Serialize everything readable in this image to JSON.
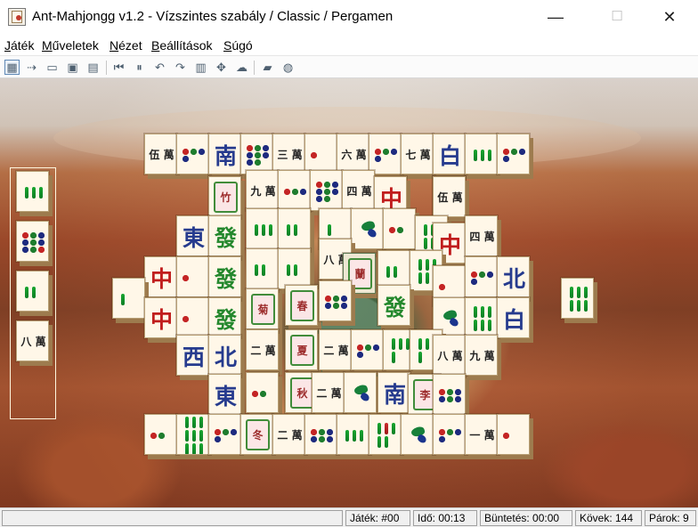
{
  "window": {
    "title": "Ant-Mahjongg v1.2 - Vízszintes szabály / Classic / Pergamen",
    "minimize": "—",
    "maximize": "☐",
    "close": "✕"
  },
  "menu": [
    "Játék",
    "Műveletek",
    "Nézet",
    "Beállítások",
    "Súgó"
  ],
  "toolbar": [
    {
      "icon": "new-game-icon",
      "glyph": "▦"
    },
    {
      "icon": "restart-icon",
      "glyph": "⇢"
    },
    {
      "icon": "open-icon",
      "glyph": "▭"
    },
    {
      "icon": "save-icon",
      "glyph": "▣"
    },
    {
      "icon": "save-as-icon",
      "glyph": "▤"
    },
    {
      "icon": "undo-all-icon",
      "glyph": "⏮"
    },
    {
      "icon": "pause-icon",
      "glyph": "⏸"
    },
    {
      "icon": "undo-icon",
      "glyph": "↶"
    },
    {
      "icon": "redo-icon",
      "glyph": "↷"
    },
    {
      "icon": "show-moves-icon",
      "glyph": "▥"
    },
    {
      "icon": "shuffle-icon",
      "glyph": "✥"
    },
    {
      "icon": "hint-icon",
      "glyph": "☁"
    },
    {
      "icon": "help-book-icon",
      "glyph": "▰"
    },
    {
      "icon": "about-icon",
      "glyph": "◍"
    }
  ],
  "board": {
    "background": "canyon",
    "selected_tile": "蘭",
    "tiles": [
      [
        "伍\n萬"
      ],
      [
        "4 circles"
      ],
      [
        "南"
      ],
      [
        "8 circles"
      ],
      [
        "三\n萬"
      ],
      [
        "1 circle"
      ],
      [
        "六\n萬"
      ],
      [
        "4 circles"
      ],
      [
        "七\n萬"
      ],
      [
        "白"
      ],
      [
        "3 bamboo"
      ],
      [
        "4 circles"
      ],
      [
        "竹"
      ],
      [
        "九\n萬"
      ],
      [
        "3 circles"
      ],
      [
        "8 circles"
      ],
      [
        "四\n萬"
      ],
      [
        "中"
      ],
      [
        "四\n萬"
      ],
      [
        "伍\n萬"
      ],
      [
        "東"
      ],
      [
        "發"
      ],
      [
        "3 bamboo"
      ],
      [
        "2 bamboo"
      ],
      [
        "1 bamboo"
      ],
      [
        "bird"
      ],
      [
        "2 circles"
      ],
      [
        "6 bamboo"
      ],
      [
        "中"
      ],
      [
        "四\n萬"
      ],
      [
        "中"
      ],
      [
        "1 circle"
      ],
      [
        "發"
      ],
      [
        "2 bamboo"
      ],
      [
        "2 bamboo"
      ],
      [
        "八\n萬"
      ],
      [
        "蘭"
      ],
      [
        "2 bamboo"
      ],
      [
        "6 bamboo"
      ],
      [
        "1 circle"
      ],
      [
        "4 circles"
      ],
      [
        "北"
      ],
      [
        "1 bamboo"
      ],
      [
        "中"
      ],
      [
        "1 circle"
      ],
      [
        "發"
      ],
      [
        "菊"
      ],
      [
        "春"
      ],
      [
        "6 circles"
      ],
      [
        "發"
      ],
      [
        "bird"
      ],
      [
        "6 bamboo"
      ],
      [
        "白"
      ],
      [
        "6 bamboo"
      ],
      [
        "西"
      ],
      [
        "北"
      ],
      [
        "二\n萬"
      ],
      [
        "夏"
      ],
      [
        "二\n萬"
      ],
      [
        "4 circles"
      ],
      [
        "4 bamboo"
      ],
      [
        "4 bamboo"
      ],
      [
        "八\n萬"
      ],
      [
        "九\n萬"
      ],
      [
        "東"
      ],
      [
        "2 circles"
      ],
      [
        "秋"
      ],
      [
        "二\n萬"
      ],
      [
        "bird"
      ],
      [
        "南"
      ],
      [
        "李"
      ],
      [
        "6 circles"
      ],
      [
        "2 circles"
      ],
      [
        "9 bamboo"
      ],
      [
        "4 circles"
      ],
      [
        "冬"
      ],
      [
        "二\n萬"
      ],
      [
        "6 circles"
      ],
      [
        "3 bamboo"
      ],
      [
        "5 bamboo"
      ],
      [
        "bird"
      ],
      [
        "4 circles"
      ],
      [
        "一\n萬"
      ],
      [
        "1 circle"
      ],
      [
        "六\n萬"
      ]
    ],
    "sidebar": [
      "3 bamboo",
      "9 circles",
      "2 bamboo",
      "八\n萬"
    ]
  },
  "status": {
    "blank": "",
    "game": "Játék: #00",
    "time": "Idő: 00:13",
    "penalty": "Büntetés: 00:00",
    "stones": "Kövek: 144",
    "pairs": "Párok: 9"
  },
  "colors": {
    "tile_face": "#fff7e8",
    "circle_blue": "#1e2b7f",
    "bamboo_green": "#13962c",
    "dragon_red": "#c01d1d"
  }
}
